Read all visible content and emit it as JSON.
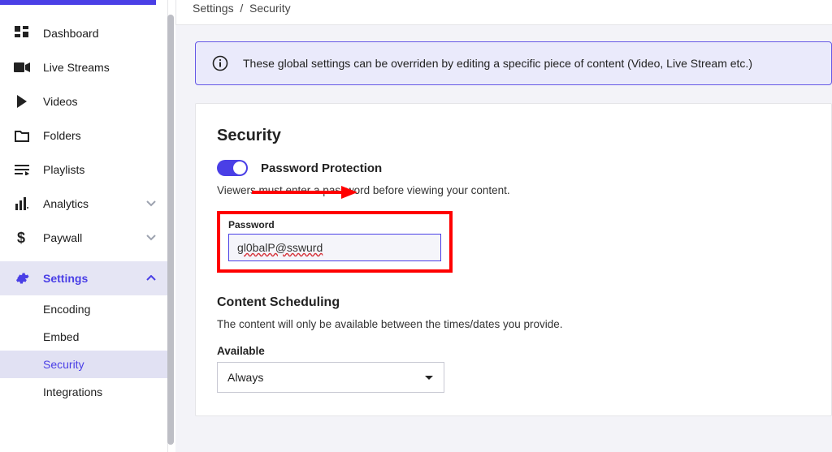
{
  "breadcrumb": {
    "parent": "Settings",
    "sep": "/",
    "current": "Security"
  },
  "sidebar": {
    "items": [
      {
        "label": "Dashboard"
      },
      {
        "label": "Live Streams"
      },
      {
        "label": "Videos"
      },
      {
        "label": "Folders"
      },
      {
        "label": "Playlists"
      },
      {
        "label": "Analytics"
      },
      {
        "label": "Paywall"
      },
      {
        "label": "Settings"
      }
    ],
    "subitems": [
      {
        "label": "Encoding"
      },
      {
        "label": "Embed"
      },
      {
        "label": "Security"
      },
      {
        "label": "Integrations"
      }
    ]
  },
  "banner": {
    "text": "These global settings can be overriden by editing a specific piece of content (Video, Live Stream etc.)"
  },
  "security": {
    "heading": "Security",
    "password_protection_label": "Password Protection",
    "password_helper": "Viewers must enter a password before viewing your content.",
    "password_field_label": "Password",
    "password_value": "gl0balP@sswurd"
  },
  "scheduling": {
    "heading": "Content Scheduling",
    "helper": "The content will only be available between the times/dates you provide.",
    "available_label": "Available",
    "available_value": "Always"
  },
  "colors": {
    "accent": "#4a3fe6",
    "annotation": "#ff0000"
  }
}
